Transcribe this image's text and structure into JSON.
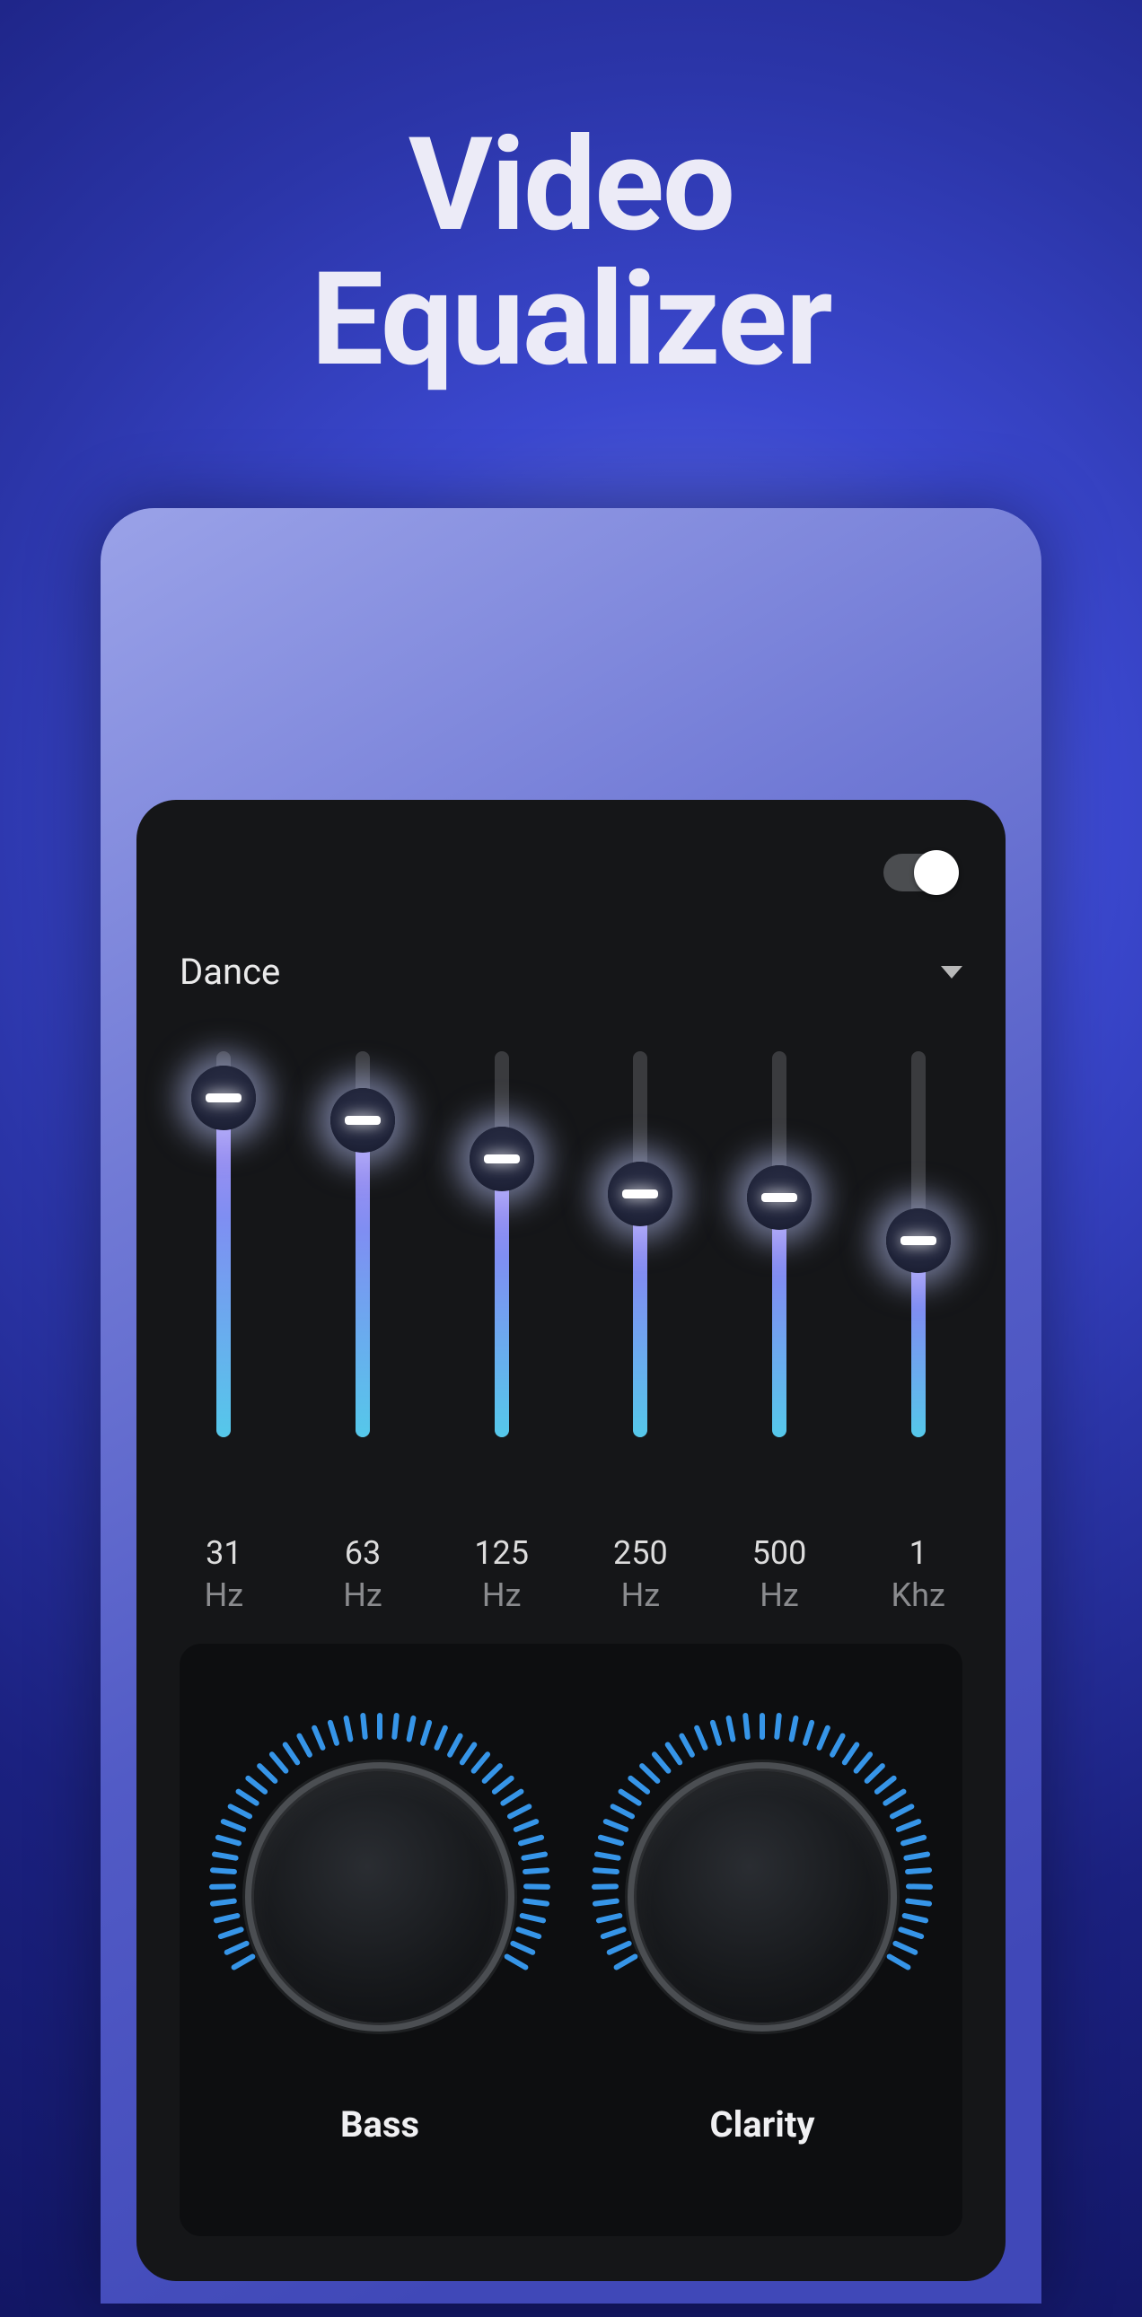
{
  "title_line1": "Video",
  "title_line2": "Equalizer",
  "toggle_on": true,
  "preset": {
    "name": "Dance"
  },
  "bands": [
    {
      "freq": "31",
      "unit": "Hz",
      "value": 88
    },
    {
      "freq": "63",
      "unit": "Hz",
      "value": 82
    },
    {
      "freq": "125",
      "unit": "Hz",
      "value": 72
    },
    {
      "freq": "250",
      "unit": "Hz",
      "value": 63
    },
    {
      "freq": "500",
      "unit": "Hz",
      "value": 62
    },
    {
      "freq": "1",
      "unit": "Khz",
      "value": 51
    }
  ],
  "knobs": [
    {
      "label": "Bass",
      "value": 100
    },
    {
      "label": "Clarity",
      "value": 100
    }
  ],
  "colors": {
    "accent": "#3695e8",
    "panel": "#151618"
  }
}
